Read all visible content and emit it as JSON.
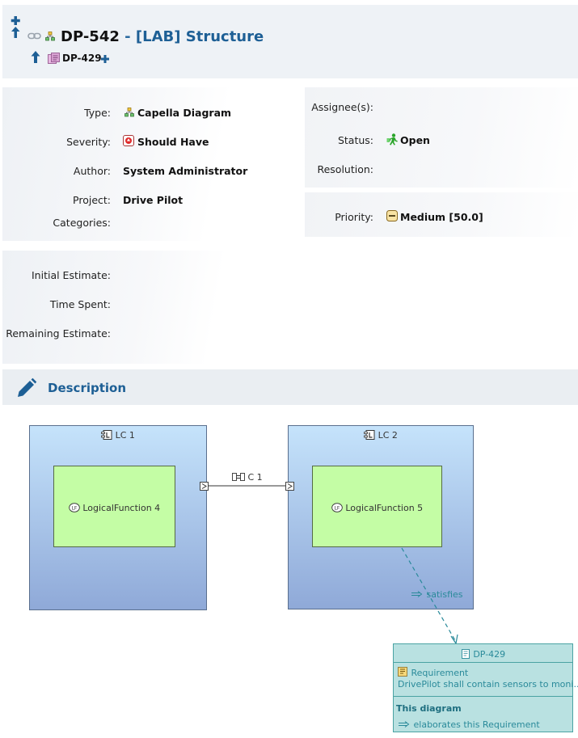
{
  "issue": {
    "key": "DP-542",
    "separator": "-",
    "summary": "[LAB] Structure",
    "parent_key": "DP-429"
  },
  "details": {
    "type_label": "Type:",
    "type_value": "Capella Diagram",
    "severity_label": "Severity:",
    "severity_value": "Should Have",
    "author_label": "Author:",
    "author_value": "System Administrator",
    "project_label": "Project:",
    "project_value": "Drive Pilot",
    "categories_label": "Categories:",
    "assignee_label": "Assignee(s):",
    "status_label": "Status:",
    "status_value": "Open",
    "resolution_label": "Resolution:",
    "priority_label": "Priority:",
    "priority_value": "Medium [50.0]"
  },
  "estimates": {
    "initial_label": "Initial Estimate:",
    "time_spent_label": "Time Spent:",
    "remaining_label": "Remaining Estimate:"
  },
  "description": {
    "title": "Description"
  },
  "diagram": {
    "lc1_title": "LC 1",
    "lc2_title": "LC 2",
    "lf4_label": "LogicalFunction 4",
    "lf5_label": "LogicalFunction 5",
    "exchange_label": "C 1",
    "satisfies_label": "satisfies",
    "req_title": "DP-429",
    "req_type": "Requirement",
    "req_text": "DrivePilot shall contain sensors to moni...",
    "req_section": "This diagram",
    "req_relation": "elaborates this Requirement"
  },
  "colors": {
    "title_blue": "#1d5f95",
    "header_bg": "#eef2f6",
    "lc_top": "#c5e3fb",
    "lc_bottom": "#8fa9d8",
    "lf_fill": "#c4fda5",
    "req_fill": "#b9e1e1",
    "status_green": "#2aa52a"
  }
}
